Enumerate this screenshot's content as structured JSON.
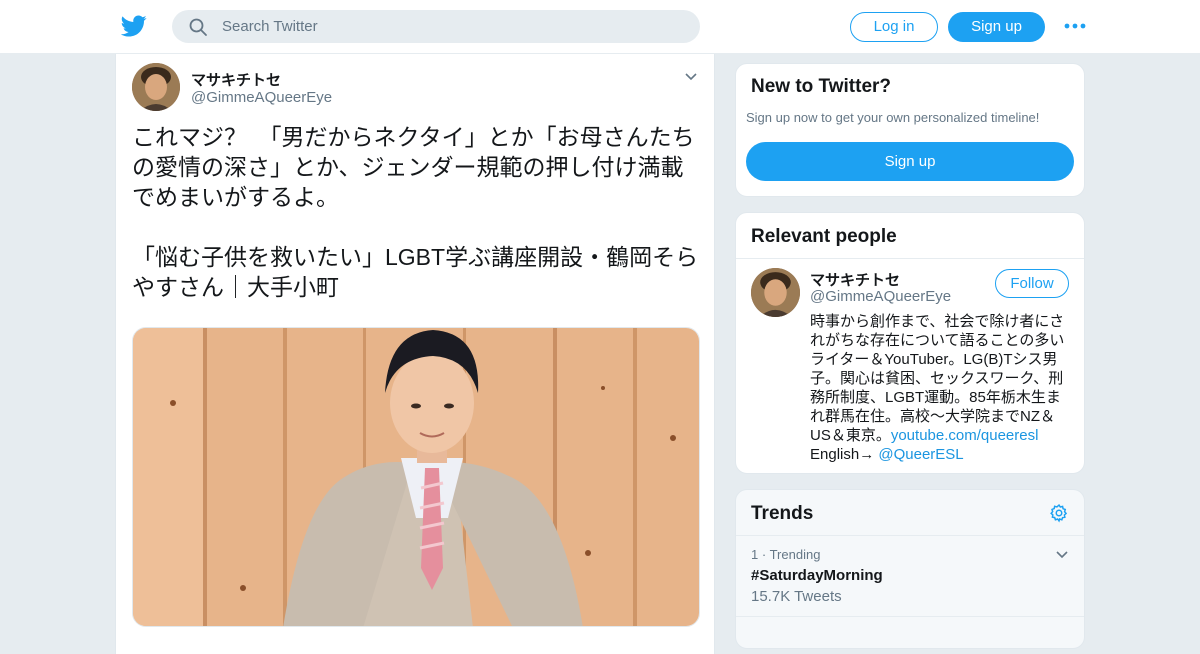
{
  "header": {
    "logo_icon": "twitter-bird-icon",
    "search_placeholder": "Search Twitter",
    "login_label": "Log in",
    "signup_label": "Sign up",
    "more_icon": "more-dots-icon",
    "brand_color": "#1da1f2"
  },
  "tweet": {
    "author_name": "マサキチトセ",
    "author_handle": "@GimmeAQueerEye",
    "text": "これマジ？　「男だからネクタイ」とか「お母さんたちの愛情の深さ」とか、ジェンダー規範の押し付け満載でめまいがするよ。\n\n「悩む子供を救いたい」LGBT学ぶ講座開設・鶴岡そらやすさん｜大手小町"
  },
  "sidebar": {
    "new_to_twitter": {
      "title": "New to Twitter?",
      "subtitle": "Sign up now to get your own personalized timeline!",
      "signup_label": "Sign up"
    },
    "relevant_people": {
      "title": "Relevant people",
      "name": "マサキチトセ",
      "handle": "@GimmeAQueerEye",
      "follow_label": "Follow",
      "bio_text": "時事から創作まで、社会で除け者にされがちな存在について語ることの多いライター＆YouTuber。LG(B)Tシス男子。関心は貧困、セックスワーク、刑務所制度、LGBT運動。85年栃木生まれ群馬在住。高校〜大学院までNZ＆US＆東京。",
      "bio_link": "youtube.com/queeresl",
      "bio_english_prefix": "English→ ",
      "bio_mention": "@QueerESL"
    },
    "trends": {
      "title": "Trends",
      "items": [
        {
          "rank": "1",
          "separator": "·",
          "label": "Trending",
          "name": "#SaturdayMorning",
          "count": "15.7K Tweets"
        }
      ]
    }
  }
}
